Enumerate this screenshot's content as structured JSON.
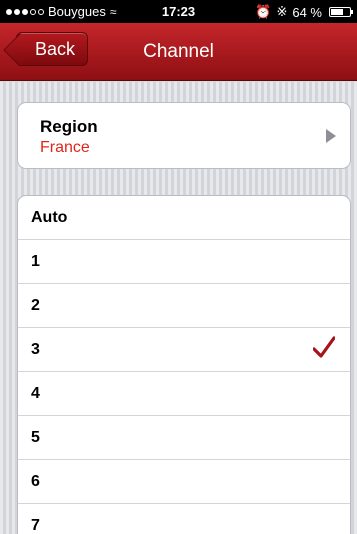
{
  "status_bar": {
    "carrier": "Bouygues",
    "time": "17:23",
    "battery": "64 %"
  },
  "nav": {
    "back_label": "Back",
    "title": "Channel"
  },
  "region": {
    "label": "Region",
    "value": "France"
  },
  "channels": [
    {
      "label": "Auto",
      "selected": false
    },
    {
      "label": "1",
      "selected": false
    },
    {
      "label": "2",
      "selected": false
    },
    {
      "label": "3",
      "selected": true
    },
    {
      "label": "4",
      "selected": false
    },
    {
      "label": "5",
      "selected": false
    },
    {
      "label": "6",
      "selected": false
    },
    {
      "label": "7",
      "selected": false
    }
  ],
  "colors": {
    "accent": "#b5181d",
    "region_value": "#e1251b",
    "checkmark": "#a8121a"
  }
}
